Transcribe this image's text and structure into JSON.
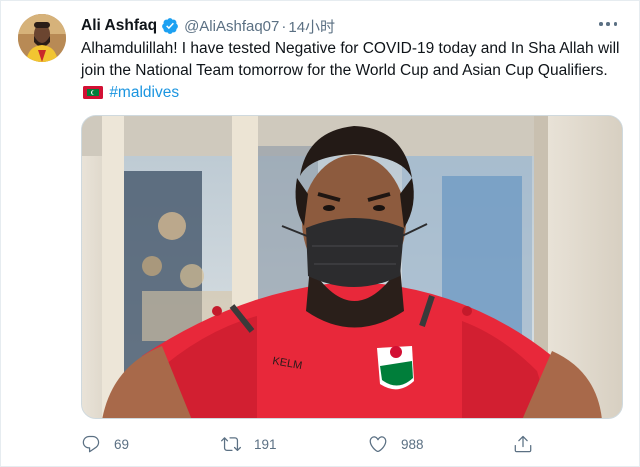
{
  "tweet": {
    "author_name": "Ali Ashfaq",
    "handle": "@AliAshfaq07",
    "separator": "·",
    "time": "14小时",
    "text_main": "Alhamdulillah! I have tested Negative for COVID-19 today and In Sha Allah will join the National Team tomorrow for the World Cup and Asian Cup Qualifiers.",
    "hashtag": "#maldives",
    "flag_icon": "maldives-flag-icon"
  },
  "actions": {
    "reply_count": "69",
    "retweet_count": "191",
    "like_count": "988"
  },
  "colors": {
    "text": "#0f1419",
    "secondary": "#5b7083",
    "link": "#1b95e0",
    "verified": "#1da1f2",
    "jersey": "#e8283a"
  }
}
